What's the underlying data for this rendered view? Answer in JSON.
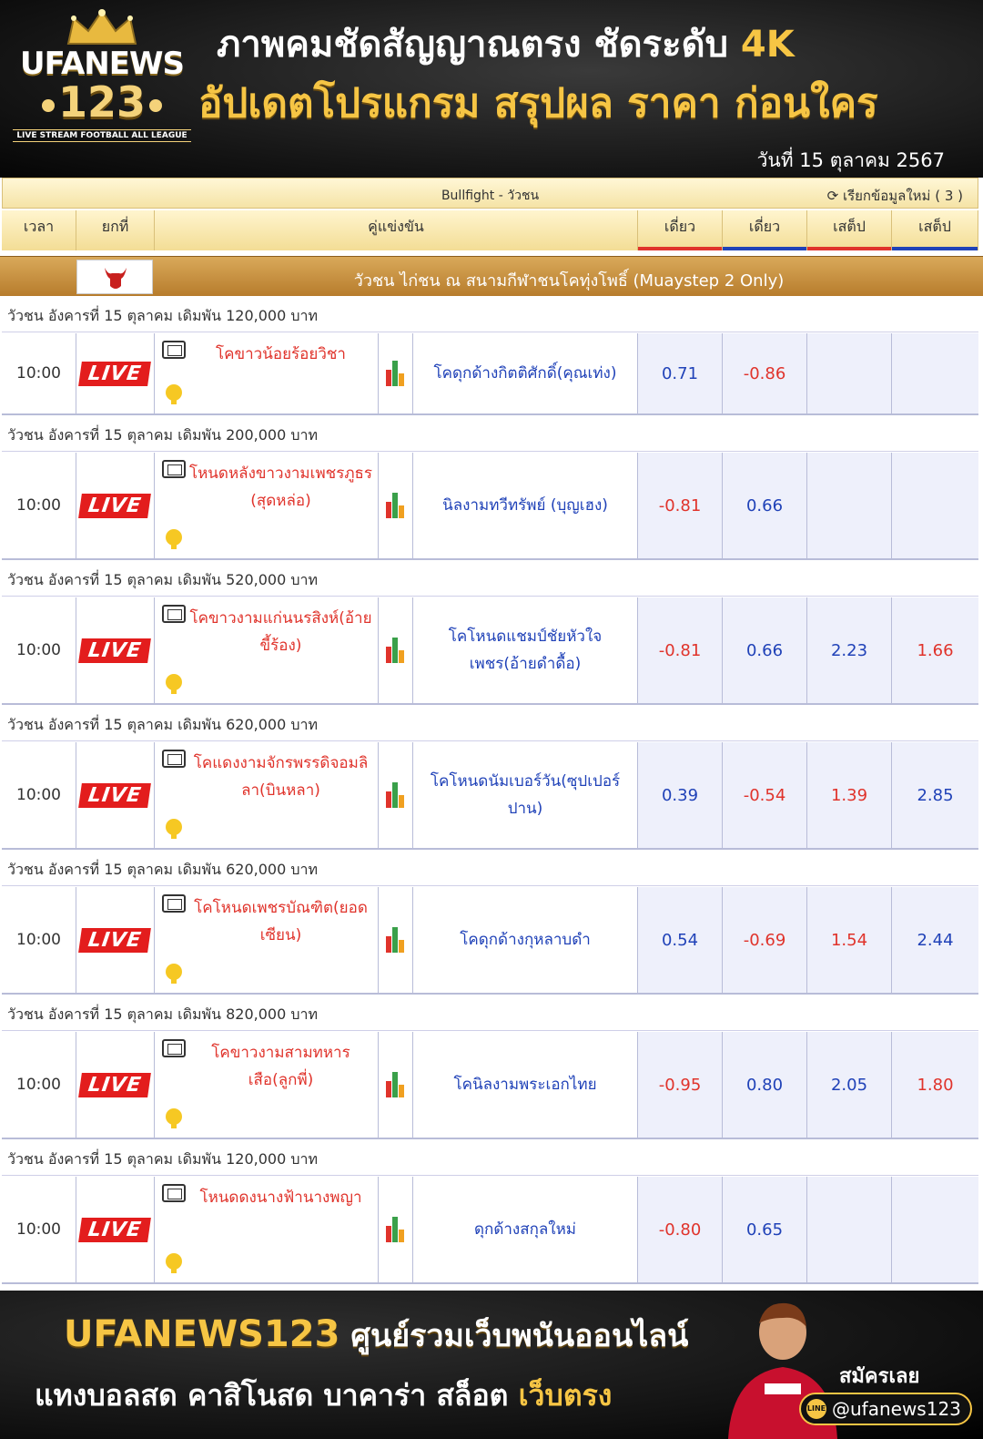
{
  "header": {
    "logo_name": "UFANEWS",
    "logo_number": "123",
    "logo_tagline": "LIVE STREAM FOOTBALL ALL LEAGUE",
    "headline_1": "ภาพคมชัดสัญญาณตรง ชัดระดับ",
    "headline_1_highlight": "4K",
    "headline_2": "อัปเดตโปรแกรม สรุปผล ราคา ก่อนใคร",
    "date": "วันที่  15 ตุลาคม 2567"
  },
  "table": {
    "title": "Bullfight - วัวชน",
    "refresh_label": "เรียกข้อมูลใหม่ ( 3 )",
    "columns": {
      "time": "เวลา",
      "round": "ยกที่",
      "match": "คู่แข่งขัน",
      "odd1": "เดี่ยว",
      "odd2": "เดี่ยว",
      "odd3": "เสต็ป",
      "odd4": "เสต็ป"
    },
    "section_title": "วัวชน ไก่ชน ณ สนามกีฬาชนโคทุ่งโพธิ์ (Muaystep 2 Only)",
    "live_label": "LIVE",
    "matches": [
      {
        "group": "วัวชน อังคารที่ 15 ตุลาคม เดิมพัน 120,000 บาท",
        "time": "10:00",
        "home": "โคขาวน้อยร้อยวิชา",
        "away": "โคดุกด้างกิตติศักดิ์(คุณเท่ง)",
        "o1": "0.71",
        "o2": "-0.86",
        "o3": "",
        "o4": ""
      },
      {
        "group": "วัวชน อังคารที่ 15 ตุลาคม เดิมพัน 200,000 บาท",
        "time": "10:00",
        "home": "โหนดหลังขาวงามเพชรภูธร (สุดหล่อ)",
        "away": "นิลงามทวีทรัพย์ (บุญเฮง)",
        "o1": "-0.81",
        "o2": "0.66",
        "o3": "",
        "o4": ""
      },
      {
        "group": "วัวชน อังคารที่ 15 ตุลาคม เดิมพัน 520,000 บาท",
        "time": "10:00",
        "home": "โคขาวงามแก่นนรสิงห์(อ้ายขี้ร้อง)",
        "away": "โคโหนดแชมป์ชัยหัวใจเพชร(อ้ายดำดื้อ)",
        "o1": "-0.81",
        "o2": "0.66",
        "o3": "2.23",
        "o4": "1.66"
      },
      {
        "group": "วัวชน อังคารที่ 15 ตุลาคม เดิมพัน 620,000 บาท",
        "time": "10:00",
        "home": "โคแดงงามจักรพรรดิจอมลิลา(บินหลา)",
        "away": "โคโหนดนัมเบอร์วัน(ซุปเปอร์ปาน)",
        "o1": "0.39",
        "o2": "-0.54",
        "o3": "1.39",
        "o4": "2.85"
      },
      {
        "group": "วัวชน อังคารที่ 15 ตุลาคม เดิมพัน 620,000 บาท",
        "time": "10:00",
        "home": "โคโหนดเพชรบัณฑิต(ยอดเซียน)",
        "away": "โคดุกด้างกุหลาบดำ",
        "o1": "0.54",
        "o2": "-0.69",
        "o3": "1.54",
        "o4": "2.44"
      },
      {
        "group": "วัวชน อังคารที่ 15 ตุลาคม เดิมพัน 820,000 บาท",
        "time": "10:00",
        "home": "โคขาวงามสามทหารเสือ(ลูกพี่)",
        "away": "โคนิลงามพระเอกไทย",
        "o1": "-0.95",
        "o2": "0.80",
        "o3": "2.05",
        "o4": "1.80"
      },
      {
        "group": "วัวชน อังคารที่ 15 ตุลาคม เดิมพัน 120,000 บาท",
        "time": "10:00",
        "home": "โหนดดงนางฟ้านางพญา",
        "away": "ดุกด้างสกุลใหม่",
        "o1": "-0.80",
        "o2": "0.65",
        "o3": "",
        "o4": ""
      }
    ]
  },
  "footer": {
    "brand": "UFANEWS123",
    "brand_sub": "ศูนย์รวมเว็บพนันออนไลน์",
    "line2": "แทงบอลสด คาสิโนสด บาคาร่า สล็อต",
    "line2_highlight": "เว็บตรง",
    "signup": "สมัครเลย",
    "handle": "@ufanews123"
  },
  "colors": {
    "accent_gold": "#f6c544",
    "live_red": "#e31d1d",
    "home_red": "#e0332b",
    "away_blue": "#2042b8"
  }
}
